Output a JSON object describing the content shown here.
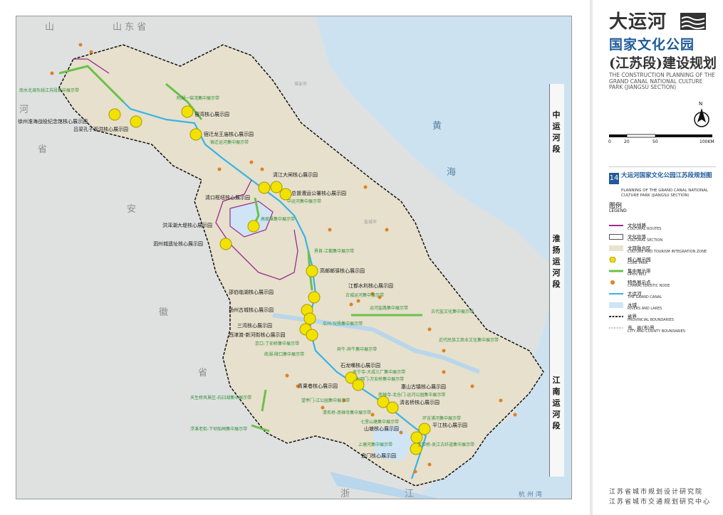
{
  "provinces": [
    {
      "id": "shandong",
      "text": "山 东 省"
    },
    {
      "id": "shan",
      "text": "山"
    },
    {
      "id": "he",
      "text": "河"
    },
    {
      "id": "sheng-west",
      "text": "省"
    },
    {
      "id": "an",
      "text": "安"
    },
    {
      "id": "hui",
      "text": "徽"
    },
    {
      "id": "sheng-sw",
      "text": "省"
    },
    {
      "id": "zhe",
      "text": "浙"
    },
    {
      "id": "jiang",
      "text": "江"
    }
  ],
  "seas": {
    "huang": "黄",
    "hai": "海",
    "hangzhou_bay": "杭 州 湾"
  },
  "sections": [
    {
      "id": "central",
      "text": "中运河段"
    },
    {
      "id": "huaiyang",
      "text": "淮扬运河段"
    },
    {
      "id": "jiangnan",
      "text": "江南运河段"
    }
  ],
  "core_parks": [
    "徐州淮海战役纪念馆核心展示园",
    "吕梁孔子观洪核心展示园",
    "窑湾核心展示园",
    "宿迁龙王庙核心展示园",
    "清江大闸核心展示园",
    "清口枢纽核心展示园",
    "总督漕运公署核心展示园",
    "洪泽湖大堤核心展示园",
    "泗州城遗址核心展示园",
    "高邮邮驿核心展示园",
    "江都水利核心展示园",
    "邵伯临湖核心展示园",
    "扬州古城核心展示园",
    "三湾核心展示园",
    "西津渡-新河街核心展示园",
    "石龙嘴核心展示园",
    "青果巷核心展示园",
    "惠山古镇核心展示园",
    "清名桥核心展示园",
    "平江核心展示园",
    "山塘核心展示园",
    "盘门核心展示园"
  ],
  "belts": [
    "南水北调东线江苏段集中展示带",
    "阿湖一窑湾集中展示带",
    "宿迁运河集中展示带",
    "中运河集中展示带",
    "高家堰集中展示带",
    "界首-江都集中展示带",
    "古城运河集中展示带",
    "运河盐路集中展示带",
    "古代盐文化集中展示带",
    "瓜州-仪扬集中展示带",
    "京口-丁卯桥集中展示带",
    "练湖-陵口集中展示带",
    "奔牛-奔牛集中展示带",
    "近代民族工商业文化集中展示带",
    "天生桥风景区-石臼湖集中展示带",
    "浮溪老街-下坝船闸集中展示带",
    "天宁寺-大成三厂集中展示带",
    "大明门-万安桥集中展示带",
    "南禅寺-北仓门-运河公园集中展示带",
    "望亭门-江公园集中展示带",
    "清名桥-南禅寺集中展示带",
    "环吉浦河集中展示带",
    "七里山塘集中展示带",
    "上塘河集中展示带",
    "宝带桥-吴江古纤道集中展示带"
  ],
  "cities": [
    "盐城市",
    "淮安市"
  ],
  "title": {
    "main": "大运河",
    "sub1": "国家文化公园",
    "sub2": "(江苏段)建设规划",
    "en": "THE CONSTRUCTION PLANNING OF THE GRAND CANAL NATIONAL CULTURE PARK (JIANGSU SECTION)"
  },
  "scale": {
    "labels": [
      "0",
      "20",
      "50",
      "100KM"
    ],
    "north": "N"
  },
  "map_title": {
    "number": "14",
    "cn": "大运河国家文化公园江苏段规划图",
    "en": "PLANNING OF THE GRAND CANAL NATIONAL CULTURE PARK (JIANGSU SECTION)"
  },
  "legend": {
    "heading_cn": "图例",
    "heading_en": "LEGEND",
    "items": [
      {
        "cn": "文化线路",
        "en": "CULTURAL ROUTES",
        "color": "#9c2a8e"
      },
      {
        "cn": "文化段落",
        "en": "CULTURAL SECTION",
        "color": "#555555"
      },
      {
        "cn": "文旅融合区",
        "en": "CULTURE AND TOURISM INTEGRATION ZONE",
        "color": "#e8e2cf"
      },
      {
        "cn": "核心展示园",
        "en": "CORE PARK",
        "color": "#f2e200"
      },
      {
        "cn": "集中展示带",
        "en": "OPEN BELT",
        "color": "#6cc04a"
      },
      {
        "cn": "特色展示点",
        "en": "CHARACTERISTIC NODE",
        "color": "#e08020"
      },
      {
        "cn": "大运河",
        "en": "THE GRAND CANAL",
        "color": "#39b3e6"
      },
      {
        "cn": "水域",
        "en": "RIVERS AND LAKES",
        "color": "#cfe4f5"
      },
      {
        "cn": "省界",
        "en": "PROVINCIAL BOUNDARIES",
        "color": "#111111"
      },
      {
        "cn": "市、县(市)界",
        "en": "CITY AND COUNTY BOUNDARIES",
        "color": "#888888"
      }
    ]
  },
  "institutes": [
    "江苏省城市规划设计研究院",
    "江苏省城市交通规划研究中心"
  ]
}
